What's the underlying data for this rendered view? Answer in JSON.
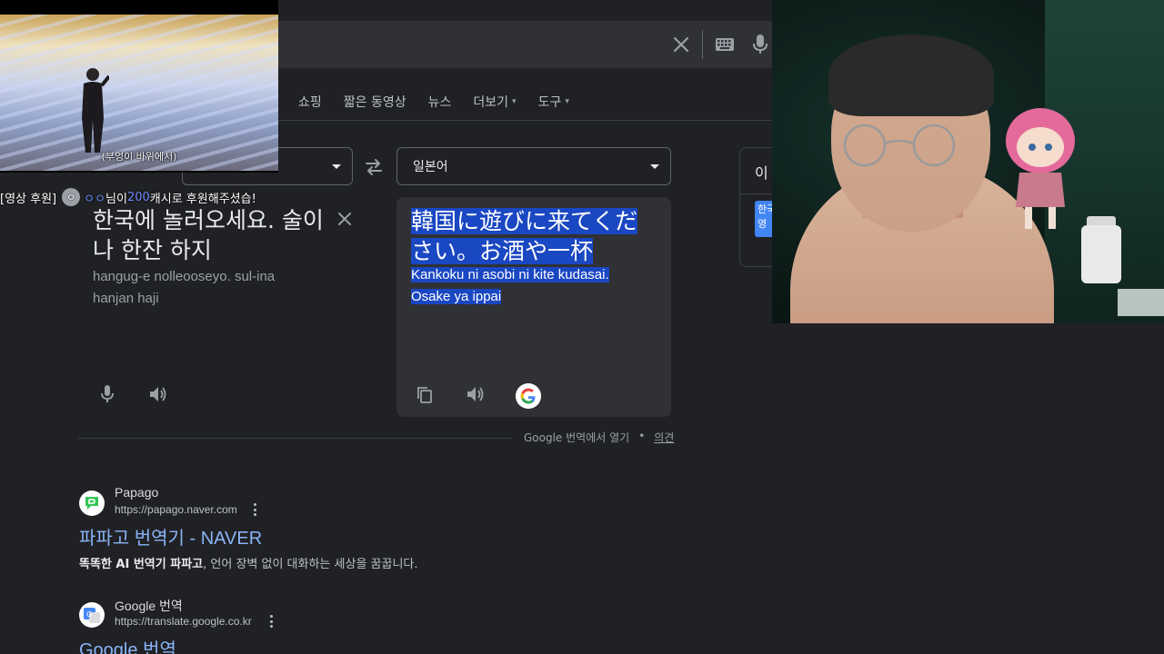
{
  "search": {
    "clear_icon": "close-icon",
    "keyboard_icon": "keyboard-icon",
    "mic_icon": "mic-icon"
  },
  "tabs": [
    {
      "label": "쇼핑"
    },
    {
      "label": "짧은 동영상"
    },
    {
      "label": "뉴스"
    },
    {
      "label": "더보기",
      "caret": "▾"
    },
    {
      "label": "도구",
      "caret": "▾"
    }
  ],
  "translator": {
    "target_language": "일본어",
    "source_text": "한국에 놀러오세요. 술이나 한잔 하지",
    "source_romanization": "hangug-e nolleooseyo. sul-ina hanjan haji",
    "target_text": "韓国に遊びに来てください。お酒や一杯",
    "target_romanization": "Kankoku ni asobi ni kite kudasai. Osake ya ippai",
    "open_link": "Google 번역에서 열기",
    "separator": "•",
    "feedback_link": "의견",
    "highlight_color": "#1a47c2"
  },
  "knowledge_panel": {
    "title": "이",
    "chip": "한국 영"
  },
  "results": [
    {
      "site": "Papago",
      "url": "https://papago.naver.com",
      "title": "파파고 번역기 - NAVER",
      "snippet_bold": "똑똑한 AI 번역기 파파고",
      "snippet_rest": ", 언어 장벽 없이 대화하는 세상을 꿈꿉니다.",
      "favicon_icon": "papago-icon"
    },
    {
      "site": "Google 번역",
      "url": "https://translate.google.co.kr",
      "title": "Google 번역",
      "favicon_icon": "google-translate-icon"
    }
  ],
  "overlay": {
    "video_caption": "(부엉이 바위에서)",
    "donation_tag": "[영상 후원]",
    "donation_avatar": "ㅇ",
    "donation_name": "ㅇㅇ",
    "donation_mid": "님이 ",
    "donation_amount": "200",
    "donation_end": "캐시로 후원해주셨습!"
  },
  "colors": {
    "background": "#202124",
    "link_blue": "#8ab4f8",
    "donation_blue": "#6b8bff"
  }
}
